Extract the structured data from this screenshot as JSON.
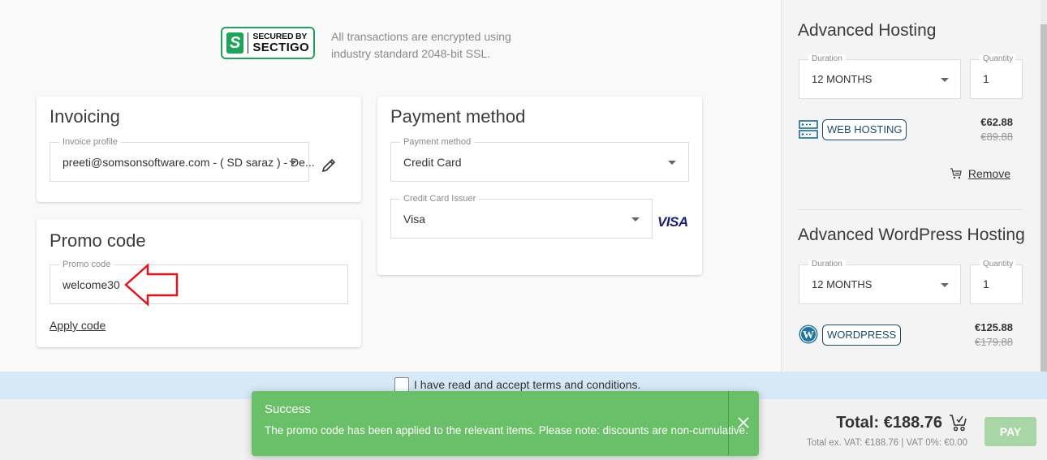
{
  "security": {
    "badge_line1": "SECURED BY",
    "badge_line2": "SECTIGO",
    "badge_letter": "S",
    "text_line1": "All transactions are encrypted using",
    "text_line2": "industry standard 2048-bit SSL.",
    "brand_color": "#1ea55a"
  },
  "invoicing": {
    "title": "Invoicing",
    "profile_label": "Invoice profile",
    "profile_value": "preeti@somsonsoftware.com - ( SD saraz ) - De..."
  },
  "promo": {
    "title": "Promo code",
    "field_label": "Promo code",
    "field_value": "welcome30",
    "apply_label": "Apply code"
  },
  "payment": {
    "title": "Payment method",
    "method_label": "Payment method",
    "method_value": "Credit Card",
    "issuer_label": "Credit Card Issuer",
    "issuer_value": "Visa",
    "issuer_logo": "VISA"
  },
  "cart": {
    "items": [
      {
        "title": "Advanced Hosting",
        "duration_label": "Duration",
        "duration_value": "12 MONTHS",
        "quantity_label": "Quantity",
        "quantity_value": "1",
        "tag": "WEB HOSTING",
        "icon": "server-icon",
        "price": "€62.88",
        "old_price": "€89.88",
        "remove_label": "Remove"
      },
      {
        "title": "Advanced WordPress Hosting",
        "duration_label": "Duration",
        "duration_value": "12 MONTHS",
        "quantity_label": "Quantity",
        "quantity_value": "1",
        "tag": "WORDPRESS",
        "icon": "wordpress-icon",
        "price": "€125.88",
        "old_price": "€179.88"
      }
    ]
  },
  "terms": {
    "label": "I have read and accept terms and conditions.",
    "checked": false
  },
  "footer": {
    "total": "Total: €188.76",
    "subtotal": "Total ex. VAT: €188.76 | VAT 0%: €0.00",
    "pay_label": "PAY"
  },
  "toast": {
    "title": "Success",
    "message": "The promo code has been applied to the relevant items. Please note: discounts are non-cumulative.",
    "color": "#6abf69"
  }
}
